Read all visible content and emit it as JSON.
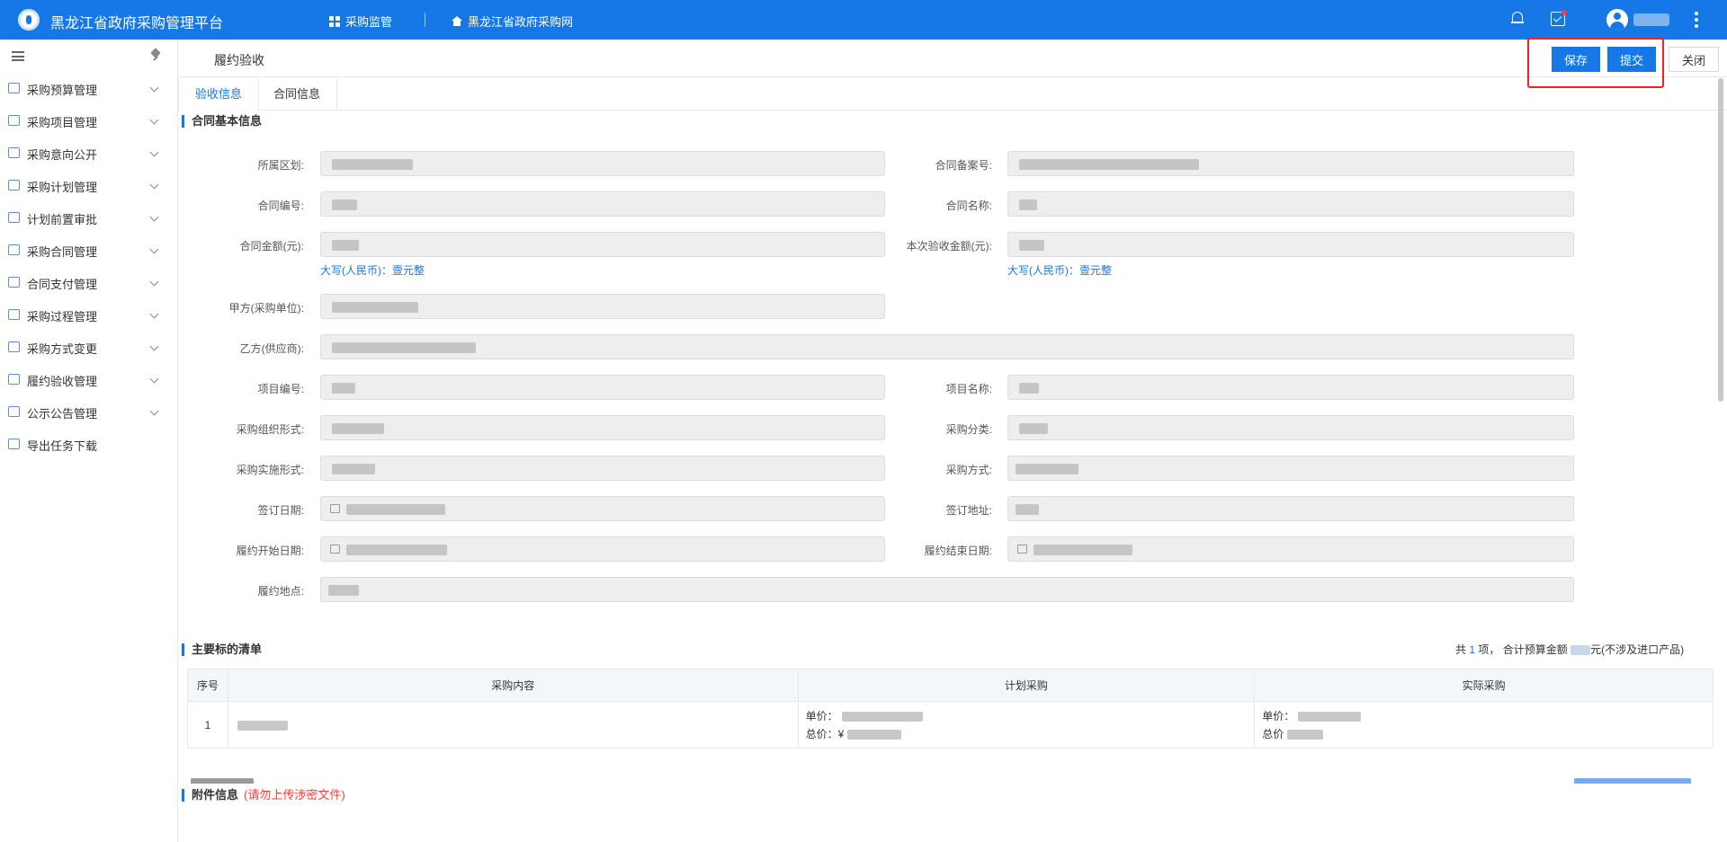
{
  "header": {
    "app_title": "黑龙江省政府采购管理平台",
    "nav": [
      {
        "label": "采购监管",
        "icon": "grid-icon"
      },
      {
        "label": "黑龙江省政府采购网",
        "icon": "home-icon"
      }
    ]
  },
  "sidebar": {
    "items": [
      {
        "label": "采购预算管理",
        "icon": "chart-icon"
      },
      {
        "label": "采购项目管理",
        "icon": "folder-icon"
      },
      {
        "label": "采购意向公开",
        "icon": "doc-icon"
      },
      {
        "label": "采购计划管理",
        "icon": "calendar-icon"
      },
      {
        "label": "计划前置审批",
        "icon": "stamp-icon"
      },
      {
        "label": "采购合同管理",
        "icon": "contract-icon"
      },
      {
        "label": "合同支付管理",
        "icon": "payment-icon"
      },
      {
        "label": "采购过程管理",
        "icon": "process-icon"
      },
      {
        "label": "采购方式变更",
        "icon": "change-icon"
      },
      {
        "label": "履约验收管理",
        "icon": "check-icon"
      },
      {
        "label": "公示公告管理",
        "icon": "notice-icon"
      },
      {
        "label": "导出任务下载",
        "icon": "download-icon"
      }
    ]
  },
  "page": {
    "title": "履约验收",
    "save_label": "保存",
    "submit_label": "提交",
    "close_label": "关闭",
    "tabs": [
      "验收信息",
      "合同信息"
    ]
  },
  "form": {
    "section_title": "合同基本信息",
    "fields": {
      "region": "所属区划:",
      "record_no": "合同备案号:",
      "contract_no": "合同编号:",
      "contract_name": "合同名称:",
      "contract_amount": "合同金额(元):",
      "accept_amount": "本次验收金额(元):",
      "party_a": "甲方(采购单位):",
      "party_b": "乙方(供应商):",
      "project_no": "项目编号:",
      "project_name": "项目名称:",
      "org_form": "采购组织形式:",
      "category": "采购分类:",
      "impl_form": "采购实施形式:",
      "method": "采购方式:",
      "sign_date": "签订日期:",
      "sign_place": "签订地址:",
      "start_date": "履约开始日期:",
      "end_date": "履约结束日期:",
      "perform_place": "履约地点:"
    },
    "amount_words_label": "大写(人民币)：",
    "amount_words_value": "壹元整"
  },
  "goods": {
    "section_title": "主要标的清单",
    "summary_prefix": "共",
    "summary_count": "1",
    "summary_mid": "项，  合计预算金额",
    "summary_suffix": "元(不涉及进口产品)",
    "columns": [
      "序号",
      "采购内容",
      "计划采购",
      "实际采购"
    ],
    "rows": [
      {
        "index": "1",
        "plan_unit": "单价：",
        "plan_total": "总价：¥",
        "actual_unit": "单价：",
        "actual_total": "总价"
      }
    ]
  },
  "attachments": {
    "section_title": "附件信息",
    "note": "(请勿上传涉密文件)"
  }
}
